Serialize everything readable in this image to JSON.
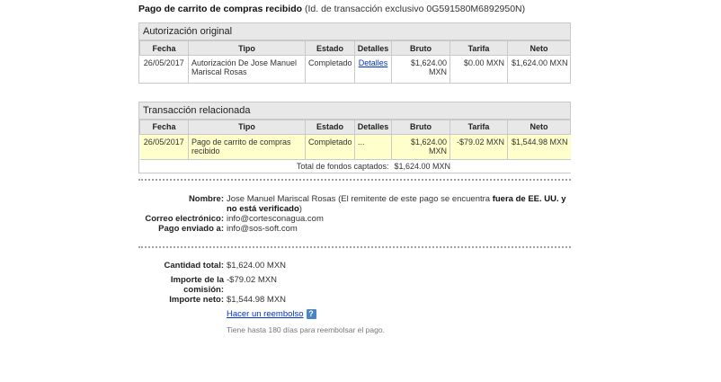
{
  "heading": {
    "title": "Pago de carrito de compras recibido",
    "subtitle": "(Id. de transacción exclusivo 0G591580M6892950N)"
  },
  "original_auth": {
    "title": "Autorización original",
    "columns": [
      "Fecha",
      "Tipo",
      "Estado",
      "Detalles",
      "Bruto",
      "Tarifa",
      "Neto"
    ],
    "row": {
      "fecha": "26/05/2017",
      "tipo": "Autorización De Jose Manuel Mariscal Rosas",
      "estado": "Completado",
      "detalles": "Detalles",
      "bruto": "$1,624.00 MXN",
      "tarifa": "$0.00 MXN",
      "neto": "$1,624.00 MXN"
    }
  },
  "related": {
    "title": "Transacción relacionada",
    "columns": [
      "Fecha",
      "Tipo",
      "Estado",
      "Detalles",
      "Bruto",
      "Tarifa",
      "Neto"
    ],
    "row": {
      "fecha": "26/05/2017",
      "tipo": "Pago de carrito de compras recibido",
      "estado": "Completado",
      "detalles": "...",
      "bruto": "$1,624.00 MXN",
      "tarifa": "-$79.02 MXN",
      "neto": "$1,544.98 MXN"
    },
    "total_label": "Total de fondos captados:",
    "total_value": "$1,624.00 MXN"
  },
  "sender": {
    "name_label": "Nombre:",
    "name_value": "Jose Manuel Mariscal Rosas",
    "name_note_pre": "(El remitente de este pago se encuentra",
    "name_note_bold": "fuera de EE. UU. y no está verificado",
    "name_note_post": ")",
    "email_label": "Correo electrónico:",
    "email_value": "info@cortesconagua.com",
    "sent_to_label": "Pago enviado a:",
    "sent_to_value": "info@sos-soft.com"
  },
  "amounts": {
    "total_label": "Cantidad total:",
    "total_value": "$1,624.00 MXN",
    "fee_label": "Importe de la comisión:",
    "fee_value": "-$79.02 MXN",
    "net_label": "Importe neto:",
    "net_value": "$1,544.98 MXN"
  },
  "refund": {
    "link_label": "Hacer un reembolso",
    "help_icon": "?",
    "note": "Tiene hasta 180 días para reembolsar el pago."
  },
  "icons": {
    "help": "help-icon"
  }
}
